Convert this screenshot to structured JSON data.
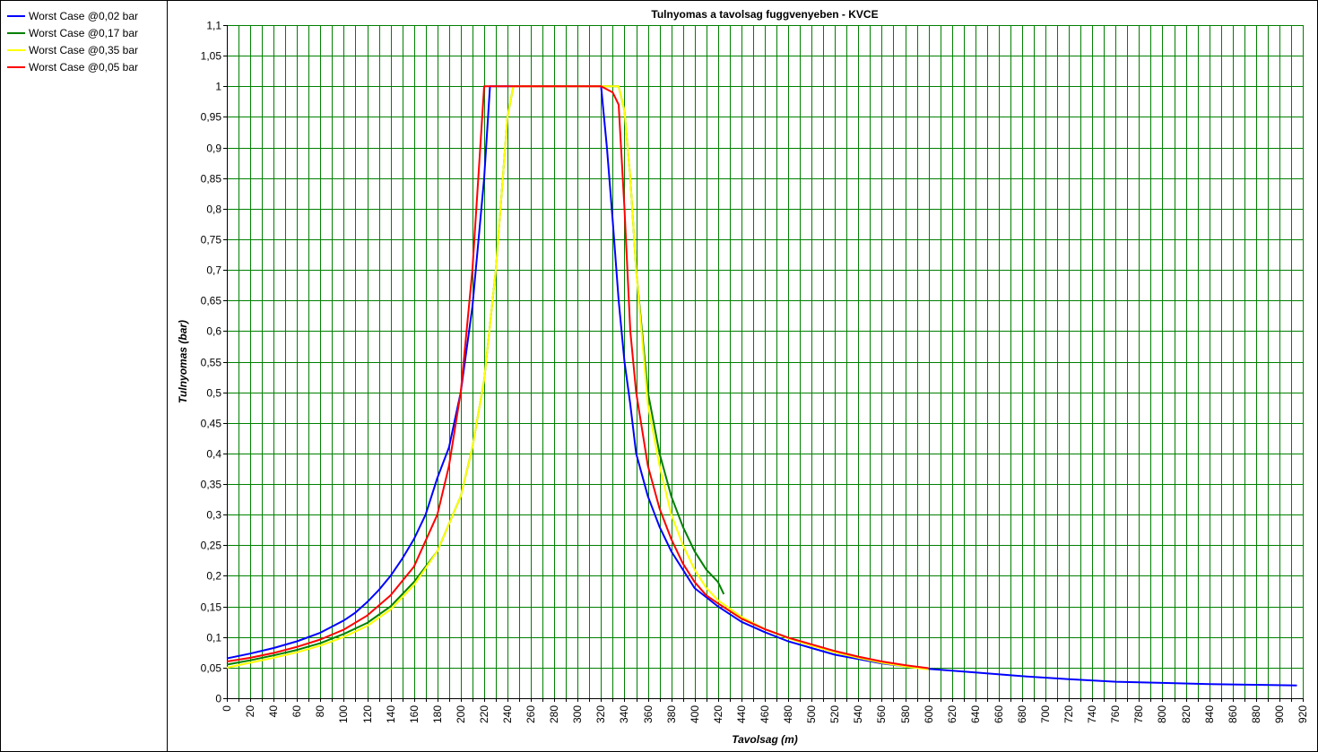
{
  "legend": {
    "items": [
      {
        "label": "Worst Case @0,02 bar",
        "color": "#0000ff"
      },
      {
        "label": "Worst Case @0,17 bar",
        "color": "#008000"
      },
      {
        "label": "Worst Case @0,35 bar",
        "color": "#ffff00"
      },
      {
        "label": "Worst Case @0,05 bar",
        "color": "#ff0000"
      }
    ]
  },
  "chart_data": {
    "type": "line",
    "title": "Tulnyomas a tavolsag fuggvenyeben - KVCE",
    "xlabel": "Tavolsag (m)",
    "ylabel": "Tulnyomas (bar)",
    "xlim": [
      0,
      920
    ],
    "ylim": [
      0,
      1.1
    ],
    "grid": true,
    "grid_color": "#008000",
    "x_tick_step": 10,
    "x_label_step": 20,
    "y_tick_step": 0.05,
    "decimal_separator": ",",
    "legend_position": "left-panel",
    "series": [
      {
        "name": "Worst Case @0,02 bar",
        "color": "#0000ff",
        "x": [
          0,
          20,
          40,
          60,
          80,
          100,
          110,
          120,
          130,
          140,
          150,
          160,
          170,
          180,
          190,
          200,
          210,
          220,
          225,
          230,
          240,
          260,
          280,
          300,
          320,
          325,
          330,
          335,
          340,
          345,
          350,
          360,
          370,
          380,
          390,
          400,
          410,
          420,
          440,
          460,
          480,
          500,
          520,
          540,
          560,
          580,
          600,
          640,
          680,
          720,
          760,
          800,
          840,
          880,
          915
        ],
        "y": [
          0.065,
          0.073,
          0.082,
          0.093,
          0.107,
          0.127,
          0.14,
          0.157,
          0.177,
          0.2,
          0.228,
          0.26,
          0.3,
          0.36,
          0.41,
          0.5,
          0.64,
          0.85,
          1.0,
          1.0,
          1.0,
          1.0,
          1.0,
          1.0,
          1.0,
          0.9,
          0.78,
          0.65,
          0.55,
          0.48,
          0.4,
          0.33,
          0.28,
          0.24,
          0.21,
          0.18,
          0.165,
          0.15,
          0.125,
          0.108,
          0.093,
          0.082,
          0.071,
          0.064,
          0.057,
          0.052,
          0.048,
          0.042,
          0.036,
          0.031,
          0.027,
          0.025,
          0.023,
          0.022,
          0.021
        ]
      },
      {
        "name": "Worst Case @0,17 bar",
        "color": "#008000",
        "x": [
          0,
          20,
          40,
          60,
          80,
          100,
          120,
          140,
          160,
          180,
          200,
          210,
          220,
          230,
          240,
          245,
          260,
          280,
          300,
          320,
          330,
          335,
          340,
          345,
          350,
          360,
          370,
          380,
          390,
          400,
          410,
          420,
          425
        ],
        "y": [
          0.055,
          0.062,
          0.07,
          0.079,
          0.09,
          0.105,
          0.123,
          0.15,
          0.19,
          0.24,
          0.33,
          0.41,
          0.52,
          0.7,
          0.95,
          1.0,
          1.0,
          1.0,
          1.0,
          1.0,
          1.0,
          1.0,
          0.96,
          0.85,
          0.7,
          0.5,
          0.4,
          0.33,
          0.28,
          0.24,
          0.21,
          0.19,
          0.17
        ]
      },
      {
        "name": "Worst Case @0,35 bar",
        "color": "#ffff00",
        "x": [
          0,
          20,
          40,
          60,
          80,
          100,
          120,
          140,
          160,
          180,
          200,
          210,
          220,
          230,
          240,
          245,
          260,
          280,
          300,
          320,
          330,
          335,
          340,
          345,
          350,
          360,
          370,
          380,
          390,
          400,
          410,
          420,
          440,
          460,
          480,
          500,
          520,
          540,
          560,
          580,
          600
        ],
        "y": [
          0.05,
          0.058,
          0.066,
          0.075,
          0.086,
          0.1,
          0.118,
          0.145,
          0.185,
          0.24,
          0.33,
          0.41,
          0.52,
          0.7,
          0.95,
          1.0,
          1.0,
          1.0,
          1.0,
          1.0,
          1.0,
          1.0,
          0.96,
          0.85,
          0.7,
          0.48,
          0.38,
          0.3,
          0.25,
          0.21,
          0.18,
          0.16,
          0.133,
          0.113,
          0.098,
          0.086,
          0.075,
          0.066,
          0.058,
          0.052,
          0.047
        ]
      },
      {
        "name": "Worst Case @0,05 bar",
        "color": "#ff0000",
        "x": [
          0,
          20,
          40,
          60,
          80,
          100,
          120,
          140,
          160,
          180,
          190,
          200,
          210,
          220,
          225,
          230,
          240,
          260,
          280,
          300,
          320,
          330,
          335,
          340,
          345,
          350,
          360,
          370,
          380,
          390,
          400,
          410,
          420,
          440,
          460,
          480,
          500,
          520,
          540,
          560,
          580,
          600
        ],
        "y": [
          0.06,
          0.066,
          0.074,
          0.084,
          0.096,
          0.112,
          0.135,
          0.168,
          0.215,
          0.3,
          0.38,
          0.5,
          0.7,
          1.0,
          1.0,
          1.0,
          1.0,
          1.0,
          1.0,
          1.0,
          1.0,
          0.99,
          0.97,
          0.8,
          0.6,
          0.5,
          0.38,
          0.31,
          0.26,
          0.22,
          0.19,
          0.168,
          0.155,
          0.13,
          0.113,
          0.099,
          0.088,
          0.077,
          0.068,
          0.06,
          0.054,
          0.049
        ]
      }
    ]
  }
}
